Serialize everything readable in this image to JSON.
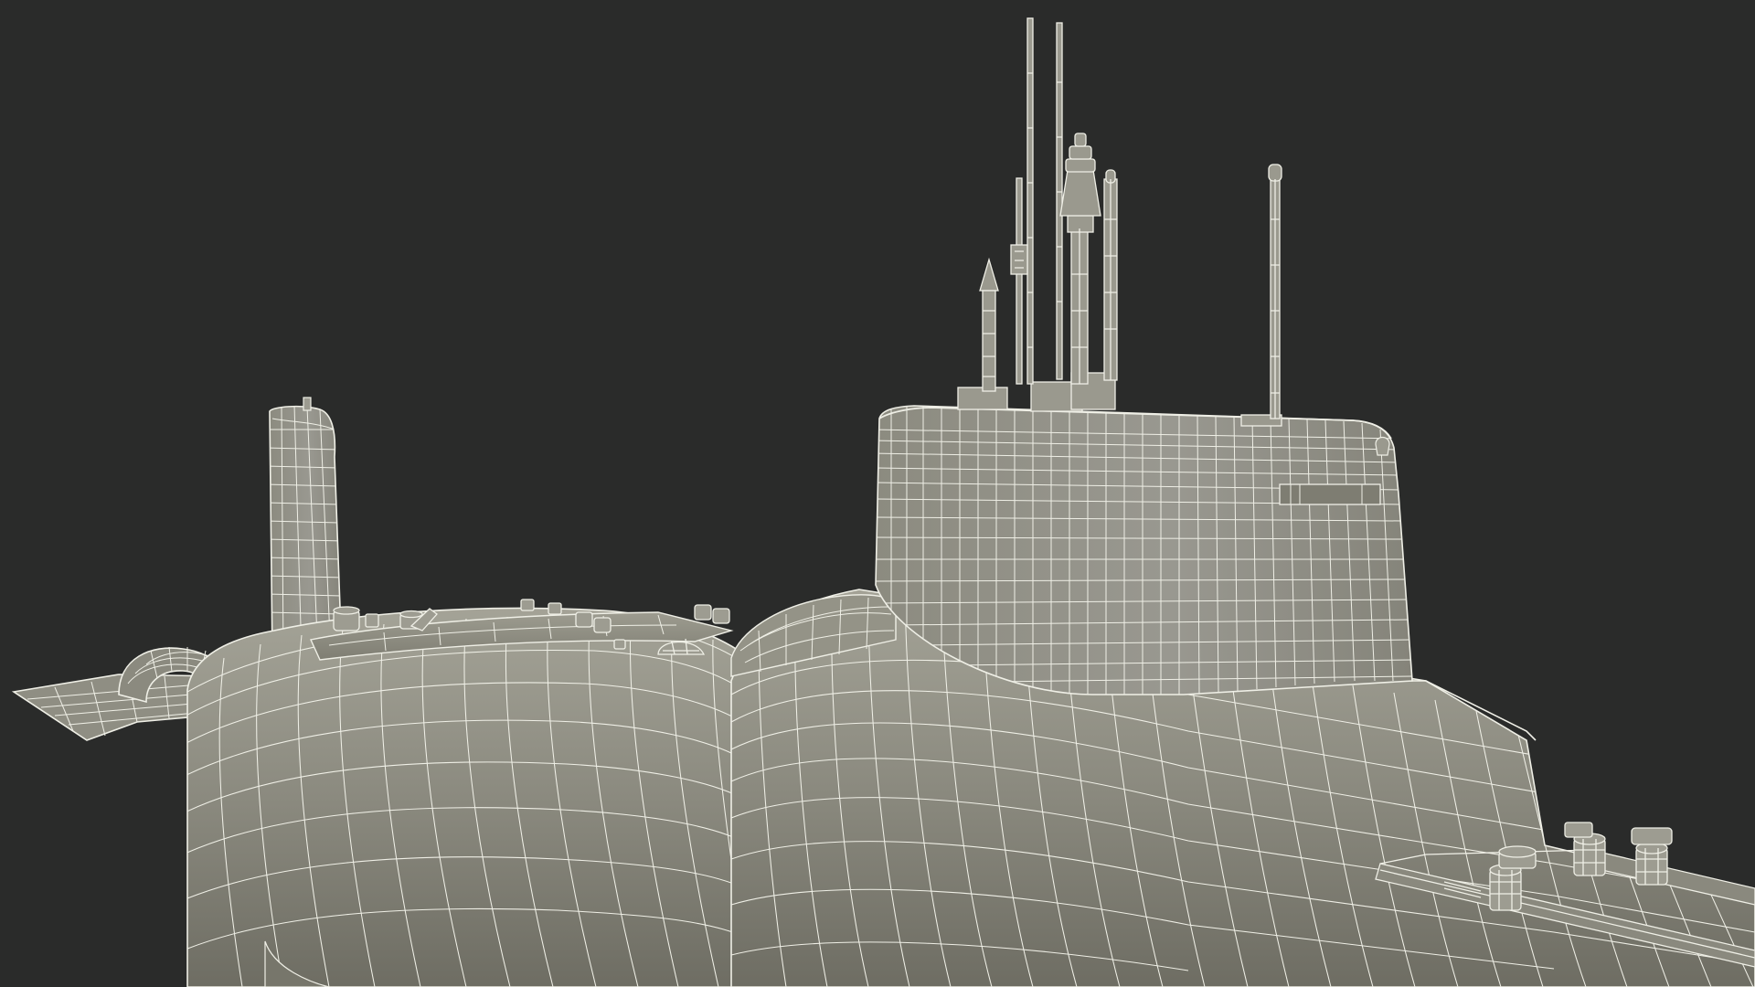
{
  "scene": {
    "subject": "submarine-wireframe-render",
    "colors": {
      "background": "#2a2b2a",
      "hull_fill": "#8e8d82",
      "hull_shadow": "#777669",
      "hull_highlight": "#a9a89c",
      "wire": "#efefe6"
    }
  }
}
